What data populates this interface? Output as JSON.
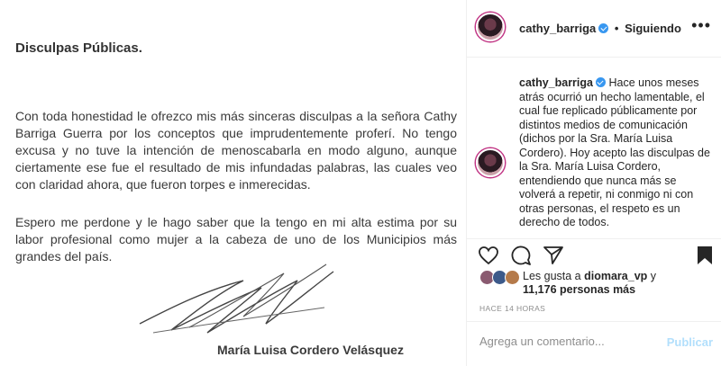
{
  "letter": {
    "heading": "Disculpas Públicas.",
    "paragraph1": "Con toda honestidad le ofrezco mis más sinceras disculpas a la señora Cathy Barriga Guerra por los conceptos que imprudentemente proferí. No tengo excusa y no tuve la intención de menoscabarla en modo alguno, aunque ciertamente ese fue el resultado de mis infundadas palabras, las cuales veo con claridad ahora, que fueron torpes e inmerecidas.",
    "paragraph2": "Espero me perdone y le hago saber que la tengo en mi alta estima por su labor profesional como mujer a la cabeza de uno de los Municipios más grandes del país.",
    "signer": "María Luisa Cordero Velásquez"
  },
  "header": {
    "username": "cathy_barriga",
    "separator": "•",
    "follow_status": "Siguiendo",
    "more_icon": "more-horizontal-icon"
  },
  "caption": {
    "username": "cathy_barriga",
    "text": "Hace unos meses atrás ocurrió un hecho lamentable, el cual fue replicado públicamente por distintos medios de comunicación (dichos por la Sra. María Luisa Cordero). Hoy acepto las disculpas de la Sra. María Luisa Cordero, entendiendo que nunca más se volverá a repetir, ni conmigo ni con otras personas, el respeto es un derecho de todos."
  },
  "actions": {
    "icons": [
      "heart-icon",
      "comment-icon",
      "share-icon",
      "bookmark-icon"
    ]
  },
  "likes": {
    "prefix": "Les gusta a ",
    "user": "diomara_vp",
    "middle": " y",
    "count": "11,176 personas más"
  },
  "timestamp": "HACE 14 HORAS",
  "comment": {
    "placeholder": "Agrega un comentario...",
    "post_label": "Publicar"
  },
  "colors": {
    "verified": "#3897f0",
    "post_disabled": "#b2dffc",
    "border": "#efefef",
    "secondary_text": "#8e8e8e"
  }
}
